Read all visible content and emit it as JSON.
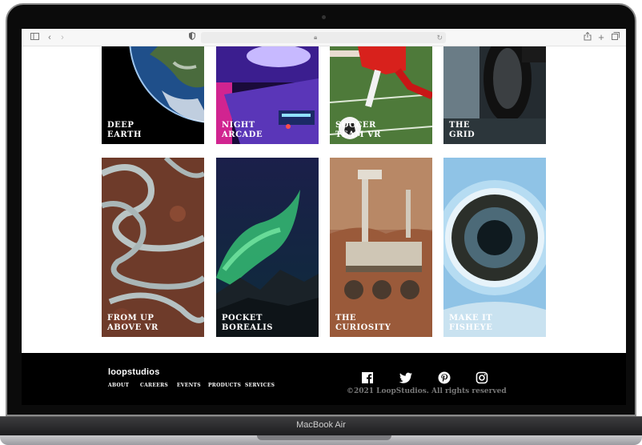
{
  "device": {
    "model": "MacBook Air"
  },
  "browser": {
    "sidebar_icon": "sidebar-icon",
    "back_icon": "chevron-left-icon",
    "forward_icon": "chevron-right-icon",
    "privacy_icon": "shield-icon",
    "share_icon": "share-icon",
    "new_tab_icon": "plus-icon",
    "tabs_icon": "tabs-icon"
  },
  "gallery": {
    "cards": [
      {
        "label": "DEEP\nEARTH"
      },
      {
        "label": "NIGHT\nARCADE"
      },
      {
        "label": "SOCCER\nTEAM VR"
      },
      {
        "label": "THE\nGRID"
      },
      {
        "label": "FROM UP\nABOVE VR"
      },
      {
        "label": "POCKET\nBOREALIS"
      },
      {
        "label": "THE\nCURIOSITY"
      },
      {
        "label": "MAKE IT\nFISHEYE"
      }
    ]
  },
  "footer": {
    "logo": "loopstudios",
    "nav": [
      "ABOUT",
      "CAREERS",
      "EVENTS",
      "PRODUCTS",
      "SERVICES"
    ],
    "social": [
      "facebook-icon",
      "twitter-icon",
      "pinterest-icon",
      "instagram-icon"
    ],
    "copyright": "©2021 LoopStudios. All rights reserved"
  }
}
